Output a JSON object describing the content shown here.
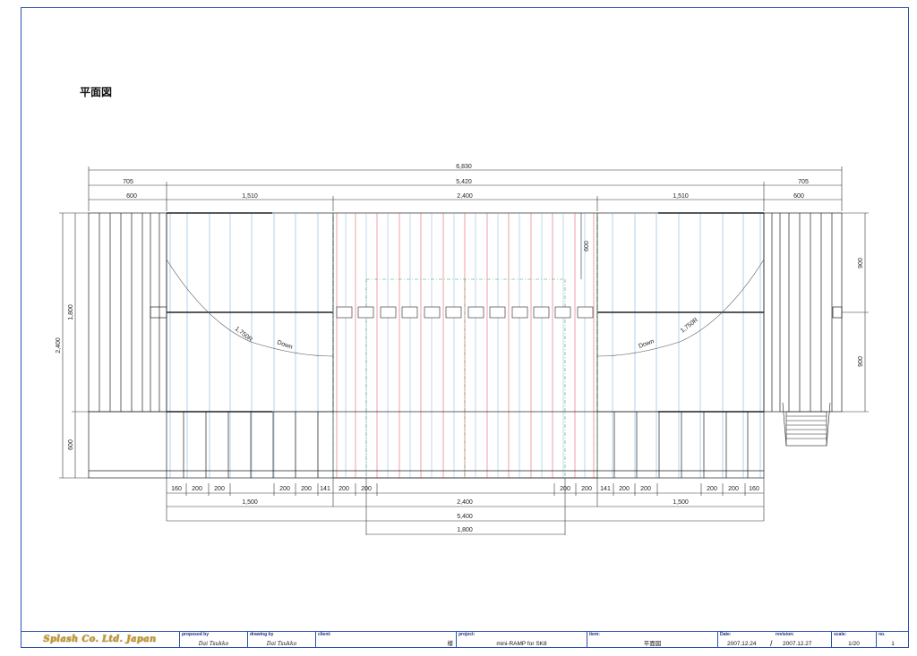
{
  "drawing": {
    "title": "平面図",
    "labels": {
      "radius": "1,750R",
      "down": "Down"
    },
    "dims_top": {
      "overall": "6,830",
      "deck_left": "705",
      "mid": "5,420",
      "deck_right": "705",
      "a1": "600",
      "a2": "1,510",
      "a3": "2,400",
      "a4": "1,510",
      "a5": "600"
    },
    "dims_left": {
      "overall": "2,400",
      "upper": "1,800",
      "lower": "600"
    },
    "dims_right": {
      "upper": "900",
      "lower": "900"
    },
    "dim_inner": "600",
    "dims_bottom_row": [
      "160",
      "200",
      "200",
      "200",
      "200",
      "141",
      "200",
      "200",
      "200",
      "200",
      "141",
      "200",
      "200",
      "200",
      "200",
      "160"
    ],
    "dims_bottom": {
      "b1": "1,500",
      "b2": "2,400",
      "b3": "1,500",
      "span": "5,400",
      "center": "1,800"
    }
  },
  "title_block": {
    "company": "Splash Co. Ltd. Japan",
    "proposed_label": "proposed by",
    "proposed_value": "Dai Tsukko",
    "drawing_label": "drawing by",
    "drawing_value": "Dai Tsukko",
    "client_label": "client:",
    "client_value": "様",
    "project_label": "project:",
    "project_value": "mini-RAMP for SK8",
    "item_label": "item:",
    "item_value": "平面図",
    "date_label": "Date:",
    "date_value": "2007.12.24",
    "revision_label": "revision:",
    "revision_value": "2007.12.27",
    "date_separator": "/",
    "scale_label": "scale:",
    "scale_value": "1/20",
    "no_label": "no.",
    "no_value": "1"
  },
  "colors": {
    "frame": "#2b4fb0",
    "line": "#222222",
    "joist_blue": "#7fb4e0",
    "joist_red": "#e06070",
    "center_green": "#40a060",
    "logo_gold": "#c99a1c"
  }
}
